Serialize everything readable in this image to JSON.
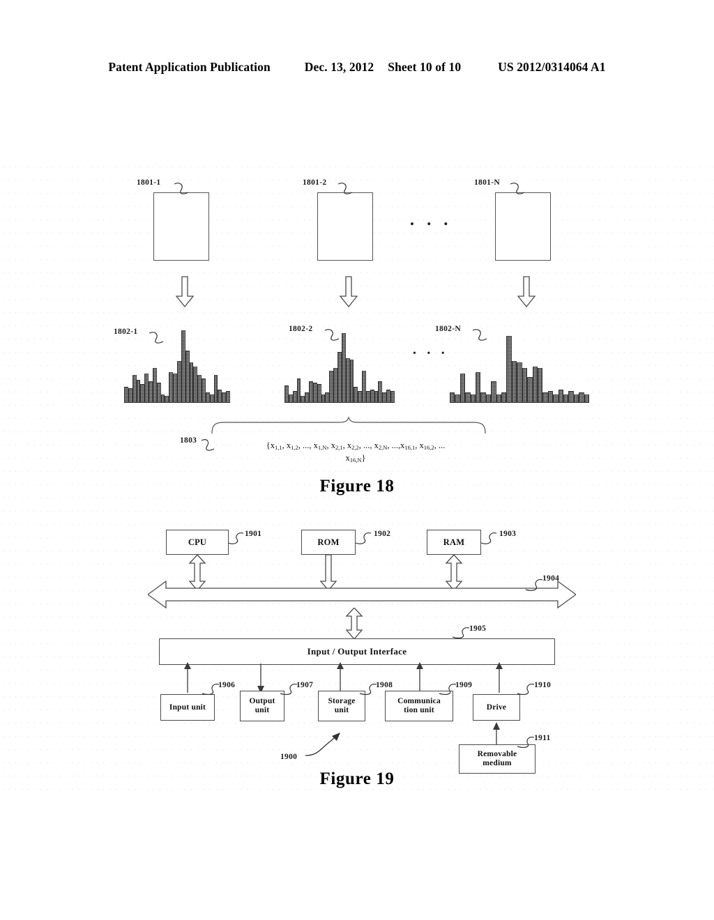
{
  "header": {
    "publication": "Patent Application Publication",
    "date": "Dec. 13, 2012",
    "sheet": "Sheet 10 of 10",
    "doc_number": "US 2012/0314064 A1"
  },
  "figure18": {
    "caption": "Figure 18",
    "image_labels": [
      "1801-1",
      "1801-2",
      "1801-N"
    ],
    "histogram_labels": [
      "1802-1",
      "1802-2",
      "1802-N"
    ],
    "feature_vector_label": "1803",
    "ellipsis": "• • •",
    "ellipsis_mid": "• • •",
    "formula_line1": "{x1,1, x1,2, ..., x1,N, x2,1, x2,2, ..., x2,N, ...,x16,1, x16,2, ...",
    "formula_line2": "x16,N}"
  },
  "figure19": {
    "caption": "Figure 19",
    "system_ref": "1900",
    "nodes": [
      {
        "label": "CPU",
        "ref": "1901"
      },
      {
        "label": "ROM",
        "ref": "1902"
      },
      {
        "label": "RAM",
        "ref": "1903"
      }
    ],
    "bus_ref": "1904",
    "io_interface": {
      "label": "Input / Output Interface",
      "ref": "1905"
    },
    "units": [
      {
        "label": "Input unit",
        "ref": "1906"
      },
      {
        "label": "Output\nunit",
        "ref": "1907"
      },
      {
        "label": "Storage\nunit",
        "ref": "1908"
      },
      {
        "label": "Communica\ntion unit",
        "ref": "1909"
      },
      {
        "label": "Drive",
        "ref": "1910"
      }
    ],
    "removable_medium": {
      "label": "Removable\nmedium",
      "ref": "1911"
    }
  },
  "chart_data": {
    "type": "bar",
    "title": "Feature histograms per image (Figure 18)",
    "xlabel": "",
    "ylabel": "",
    "ylim": [
      0,
      100
    ],
    "grid": false,
    "legend": "none",
    "series": [
      {
        "name": "1802-1",
        "values": [
          22,
          20,
          38,
          32,
          26,
          40,
          30,
          48,
          28,
          12,
          10,
          42,
          40,
          58,
          100,
          72,
          56,
          50,
          38,
          34,
          14,
          12,
          38,
          18,
          14,
          16
        ]
      },
      {
        "name": "1802-2",
        "values": [
          24,
          12,
          16,
          34,
          10,
          14,
          30,
          28,
          26,
          12,
          14,
          44,
          48,
          70,
          96,
          62,
          60,
          22,
          16,
          44,
          16,
          18,
          16,
          30,
          14,
          18,
          16
        ]
      },
      {
        "name": "1802-N",
        "values": [
          14,
          12,
          40,
          14,
          12,
          42,
          14,
          12,
          30,
          12,
          14,
          92,
          58,
          56,
          48,
          36,
          50,
          48,
          14,
          16,
          12,
          18,
          12,
          16,
          12,
          14,
          12
        ]
      }
    ]
  }
}
